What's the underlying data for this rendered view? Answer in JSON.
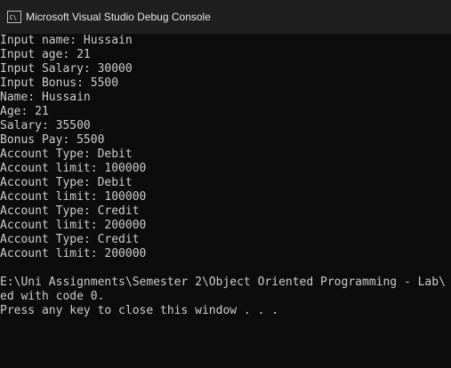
{
  "window": {
    "title": "Microsoft Visual Studio Debug Console",
    "icon": "console-app-icon"
  },
  "console": {
    "lines": [
      "Input name: Hussain",
      "Input age: 21",
      "Input Salary: 30000",
      "Input Bonus: 5500",
      "Name: Hussain",
      "Age: 21",
      "Salary: 35500",
      "Bonus Pay: 5500",
      "Account Type: Debit",
      "Account limit: 100000",
      "Account Type: Debit",
      "Account limit: 100000",
      "Account Type: Credit",
      "Account limit: 200000",
      "Account Type: Credit",
      "Account limit: 200000",
      "",
      "E:\\Uni Assignments\\Semester 2\\Object Oriented Programming - Lab\\",
      "ed with code 0.",
      "Press any key to close this window . . ."
    ]
  },
  "colors": {
    "background": "#0c0c0c",
    "titlebar": "#1f1f1f",
    "text": "#cccccc"
  }
}
